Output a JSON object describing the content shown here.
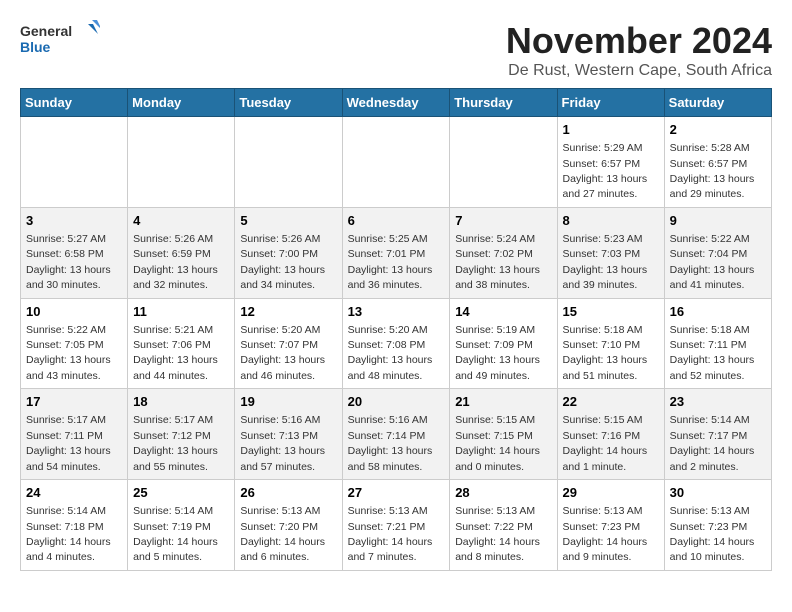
{
  "header": {
    "logo_general": "General",
    "logo_blue": "Blue",
    "month_title": "November 2024",
    "location": "De Rust, Western Cape, South Africa"
  },
  "days_of_week": [
    "Sunday",
    "Monday",
    "Tuesday",
    "Wednesday",
    "Thursday",
    "Friday",
    "Saturday"
  ],
  "weeks": [
    [
      {
        "day": "",
        "info": ""
      },
      {
        "day": "",
        "info": ""
      },
      {
        "day": "",
        "info": ""
      },
      {
        "day": "",
        "info": ""
      },
      {
        "day": "",
        "info": ""
      },
      {
        "day": "1",
        "info": "Sunrise: 5:29 AM\nSunset: 6:57 PM\nDaylight: 13 hours and 27 minutes."
      },
      {
        "day": "2",
        "info": "Sunrise: 5:28 AM\nSunset: 6:57 PM\nDaylight: 13 hours and 29 minutes."
      }
    ],
    [
      {
        "day": "3",
        "info": "Sunrise: 5:27 AM\nSunset: 6:58 PM\nDaylight: 13 hours and 30 minutes."
      },
      {
        "day": "4",
        "info": "Sunrise: 5:26 AM\nSunset: 6:59 PM\nDaylight: 13 hours and 32 minutes."
      },
      {
        "day": "5",
        "info": "Sunrise: 5:26 AM\nSunset: 7:00 PM\nDaylight: 13 hours and 34 minutes."
      },
      {
        "day": "6",
        "info": "Sunrise: 5:25 AM\nSunset: 7:01 PM\nDaylight: 13 hours and 36 minutes."
      },
      {
        "day": "7",
        "info": "Sunrise: 5:24 AM\nSunset: 7:02 PM\nDaylight: 13 hours and 38 minutes."
      },
      {
        "day": "8",
        "info": "Sunrise: 5:23 AM\nSunset: 7:03 PM\nDaylight: 13 hours and 39 minutes."
      },
      {
        "day": "9",
        "info": "Sunrise: 5:22 AM\nSunset: 7:04 PM\nDaylight: 13 hours and 41 minutes."
      }
    ],
    [
      {
        "day": "10",
        "info": "Sunrise: 5:22 AM\nSunset: 7:05 PM\nDaylight: 13 hours and 43 minutes."
      },
      {
        "day": "11",
        "info": "Sunrise: 5:21 AM\nSunset: 7:06 PM\nDaylight: 13 hours and 44 minutes."
      },
      {
        "day": "12",
        "info": "Sunrise: 5:20 AM\nSunset: 7:07 PM\nDaylight: 13 hours and 46 minutes."
      },
      {
        "day": "13",
        "info": "Sunrise: 5:20 AM\nSunset: 7:08 PM\nDaylight: 13 hours and 48 minutes."
      },
      {
        "day": "14",
        "info": "Sunrise: 5:19 AM\nSunset: 7:09 PM\nDaylight: 13 hours and 49 minutes."
      },
      {
        "day": "15",
        "info": "Sunrise: 5:18 AM\nSunset: 7:10 PM\nDaylight: 13 hours and 51 minutes."
      },
      {
        "day": "16",
        "info": "Sunrise: 5:18 AM\nSunset: 7:11 PM\nDaylight: 13 hours and 52 minutes."
      }
    ],
    [
      {
        "day": "17",
        "info": "Sunrise: 5:17 AM\nSunset: 7:11 PM\nDaylight: 13 hours and 54 minutes."
      },
      {
        "day": "18",
        "info": "Sunrise: 5:17 AM\nSunset: 7:12 PM\nDaylight: 13 hours and 55 minutes."
      },
      {
        "day": "19",
        "info": "Sunrise: 5:16 AM\nSunset: 7:13 PM\nDaylight: 13 hours and 57 minutes."
      },
      {
        "day": "20",
        "info": "Sunrise: 5:16 AM\nSunset: 7:14 PM\nDaylight: 13 hours and 58 minutes."
      },
      {
        "day": "21",
        "info": "Sunrise: 5:15 AM\nSunset: 7:15 PM\nDaylight: 14 hours and 0 minutes."
      },
      {
        "day": "22",
        "info": "Sunrise: 5:15 AM\nSunset: 7:16 PM\nDaylight: 14 hours and 1 minute."
      },
      {
        "day": "23",
        "info": "Sunrise: 5:14 AM\nSunset: 7:17 PM\nDaylight: 14 hours and 2 minutes."
      }
    ],
    [
      {
        "day": "24",
        "info": "Sunrise: 5:14 AM\nSunset: 7:18 PM\nDaylight: 14 hours and 4 minutes."
      },
      {
        "day": "25",
        "info": "Sunrise: 5:14 AM\nSunset: 7:19 PM\nDaylight: 14 hours and 5 minutes."
      },
      {
        "day": "26",
        "info": "Sunrise: 5:13 AM\nSunset: 7:20 PM\nDaylight: 14 hours and 6 minutes."
      },
      {
        "day": "27",
        "info": "Sunrise: 5:13 AM\nSunset: 7:21 PM\nDaylight: 14 hours and 7 minutes."
      },
      {
        "day": "28",
        "info": "Sunrise: 5:13 AM\nSunset: 7:22 PM\nDaylight: 14 hours and 8 minutes."
      },
      {
        "day": "29",
        "info": "Sunrise: 5:13 AM\nSunset: 7:23 PM\nDaylight: 14 hours and 9 minutes."
      },
      {
        "day": "30",
        "info": "Sunrise: 5:13 AM\nSunset: 7:23 PM\nDaylight: 14 hours and 10 minutes."
      }
    ]
  ]
}
